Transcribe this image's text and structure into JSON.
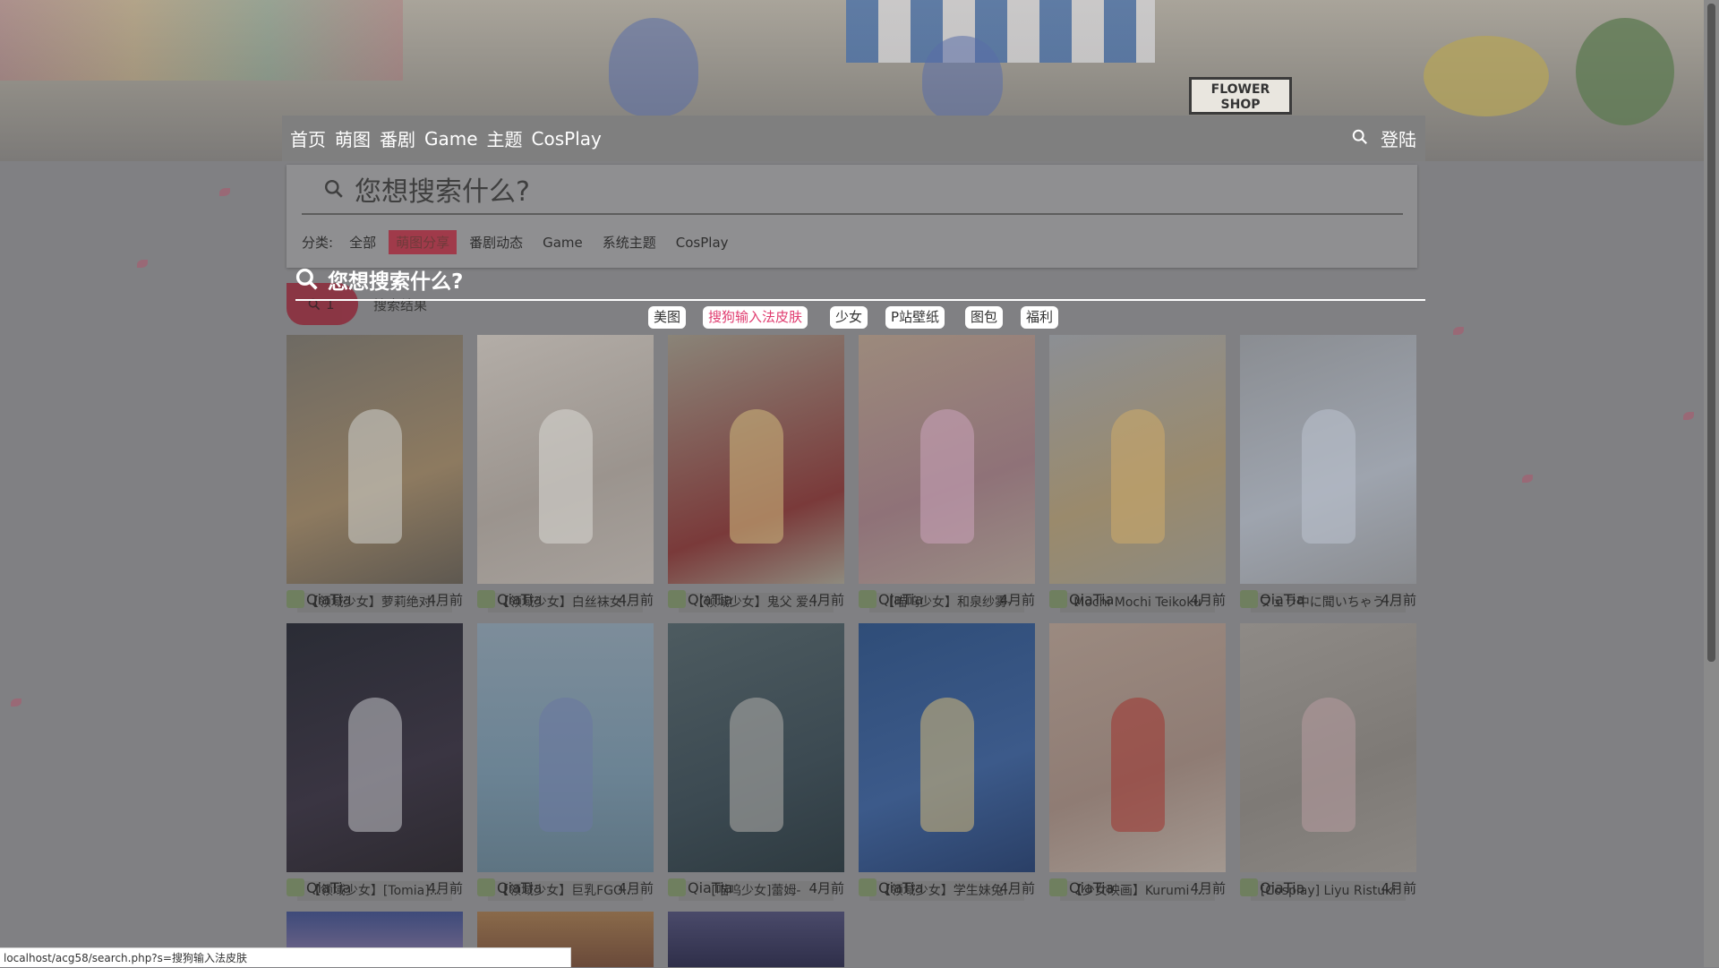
{
  "banner": {
    "shop_sign": "FLOWER\nSHOP"
  },
  "navbar": {
    "links": [
      "首页",
      "萌图",
      "番剧",
      "Game",
      "主题",
      "CosPlay"
    ],
    "login": "登陆"
  },
  "search_panel": {
    "placeholder": "您想搜索什么?",
    "category_label": "分类:",
    "categories": [
      "全部",
      "萌图分享",
      "番剧动态",
      "Game",
      "系统主题",
      "CosPlay"
    ],
    "active_category": "萌图分享"
  },
  "overlay_search": {
    "placeholder": "您想搜索什么?"
  },
  "result": {
    "count": "1",
    "label": "搜索结果"
  },
  "tags": [
    "美图",
    "搜狗输入法皮肤",
    "少女",
    "P站壁纸",
    "图包",
    "福利"
  ],
  "active_tag": "搜狗输入法皮肤",
  "posts": [
    {
      "title": "【领域少女】萝莉绝对...",
      "author": "QiaTia",
      "time": "4月前"
    },
    {
      "title": "【领域少女】白丝袜女...",
      "author": "QiaTia",
      "time": "4月前"
    },
    {
      "title": "【领域少女】鬼父 爱...",
      "author": "QiaTia",
      "time": "4月前"
    },
    {
      "title": "【喵呜少女】和泉纱雾-",
      "author": "QiaTia",
      "time": "4月前"
    },
    {
      "title": "Mochi Mochi Teikoku",
      "author": "QiaTia",
      "time": "4月前"
    },
    {
      "title": "フェラ中に聞いちゃう...",
      "author": "QiaTia",
      "time": "4月前"
    },
    {
      "title": "【领域少女】[Tomia]...",
      "author": "QiaTia",
      "time": "4月前"
    },
    {
      "title": "【领域少女】巨乳FGO...",
      "author": "QiaTia",
      "time": "4月前"
    },
    {
      "title": "[喵呜少女]蕾姆-",
      "author": "QiaTia",
      "time": "4月前"
    },
    {
      "title": "【领域少女】学生妹兔...",
      "author": "QiaTia",
      "time": "4月前"
    },
    {
      "title": "【少女映画】Kurumi ...",
      "author": "QiaTia",
      "time": "4月前"
    },
    {
      "title": "[Cosplay] Liyu Ristuki",
      "author": "QiaTia",
      "time": "4月前"
    }
  ],
  "status_url": "localhost/acg58/search.php?s=搜狗输入法皮肤",
  "colors": {
    "accent": "#e03d70",
    "active_category_bg": "#a03a4a",
    "navbar_bg": "#7f7f7f",
    "page_bg": "#808083"
  },
  "icons": {
    "search": "search-icon",
    "avatar": "avatar-icon"
  }
}
